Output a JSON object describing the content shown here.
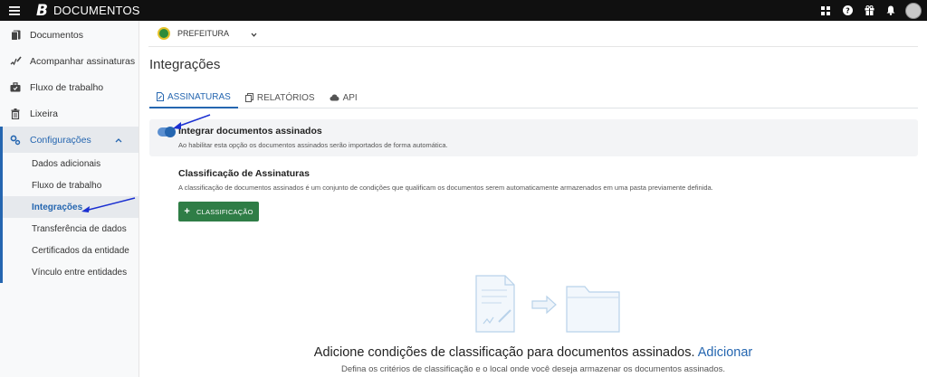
{
  "topbar": {
    "logo": "B",
    "app_name": "DOCUMENTOS",
    "icons": [
      "grid-icon",
      "help-icon",
      "gift-icon",
      "bell-icon",
      "avatar"
    ]
  },
  "sidebar": {
    "items": [
      {
        "label": "Documentos",
        "icon": "document-icon"
      },
      {
        "label": "Acompanhar assinaturas",
        "icon": "signature-icon"
      },
      {
        "label": "Fluxo de trabalho",
        "icon": "briefcase-icon"
      },
      {
        "label": "Lixeira",
        "icon": "trash-icon"
      },
      {
        "label": "Configurações",
        "icon": "gear-icon"
      }
    ],
    "sub_items": [
      {
        "label": "Dados adicionais"
      },
      {
        "label": "Fluxo de trabalho"
      },
      {
        "label": "Integrações"
      },
      {
        "label": "Transferência de dados"
      },
      {
        "label": "Certificados da entidade"
      },
      {
        "label": "Vínculo entre entidades"
      }
    ]
  },
  "org": {
    "name": "PREFEITURA"
  },
  "page": {
    "title": "Integrações"
  },
  "tabs": [
    {
      "label": "ASSINATURAS",
      "icon": "signature-doc-icon"
    },
    {
      "label": "RELATÓRIOS",
      "icon": "copy-icon"
    },
    {
      "label": "API",
      "icon": "cloud-icon"
    }
  ],
  "integrate": {
    "title": "Integrar documentos assinados",
    "description": "Ao habilitar esta opção os documentos assinados serão importados de forma automática.",
    "enabled": true
  },
  "classification": {
    "title": "Classificação de Assinaturas",
    "description": "A classificação de documentos assinados é um conjunto de condições que qualificam os documentos serem automaticamente armazenados em uma pasta previamente definida.",
    "button_label": "CLASSIFICAÇÃO"
  },
  "empty_state": {
    "title": "Adicione condições de classificação para documentos assinados.",
    "link": "Adicionar",
    "description": "Defina os critérios de classificação e o local onde você deseja armazenar os documentos assinados."
  },
  "colors": {
    "primary": "#2566b0",
    "button_green": "#2f7d46",
    "topbar": "#101010"
  }
}
